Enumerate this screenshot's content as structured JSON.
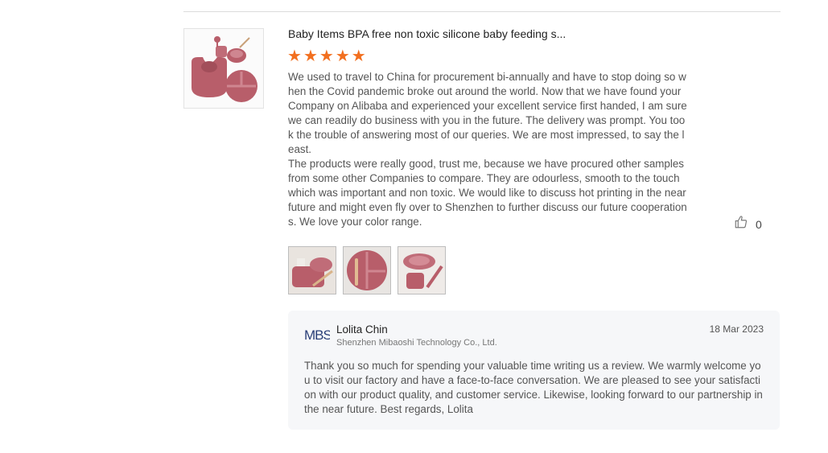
{
  "review": {
    "product_title": "Baby Items BPA free non toxic silicone baby feeding s...",
    "rating": 5,
    "max_rating": 5,
    "body_paragraphs": [
      "We used to travel to China for procurement bi-annually and have to stop doing so when the Covid pandemic broke out around the world. Now that we have found your Company on Alibaba and experienced your excellent service first handed, I am sure we can readily do business with you in the future. The delivery was prompt. You took the trouble of answering most of our queries. We are most impressed, to say the least.",
      "The products were really good, trust me, because we have procured other samples from some other Companies to compare. They are odourless, smooth to the touch which was important and non toxic. We would like to discuss hot printing in the near future and might even fly over to Shenzhen to further discuss our future cooperations. We love your color range."
    ],
    "likes": "0",
    "photo_count": 3
  },
  "reply": {
    "logo_text": "MBS",
    "name": "Lolita Chin",
    "company": "Shenzhen Mibaoshi Technology Co., Ltd.",
    "date": "18 Mar 2023",
    "body": "Thank you so much for spending your valuable time writing us a review. We warmly welcome you to visit our factory and have a face-to-face conversation. We are pleased to see your satisfaction with our product quality, and customer service. Likewise, looking forward to our partnership in the near future. Best regards, Lolita"
  },
  "colors": {
    "star": "#f26f1f",
    "product_pink": "#b85e6a",
    "reply_bg": "#f6f7f9",
    "logo_blue": "#2a3f78"
  },
  "icons": {
    "like": "thumbs-up-icon",
    "rating": "star-icon"
  }
}
